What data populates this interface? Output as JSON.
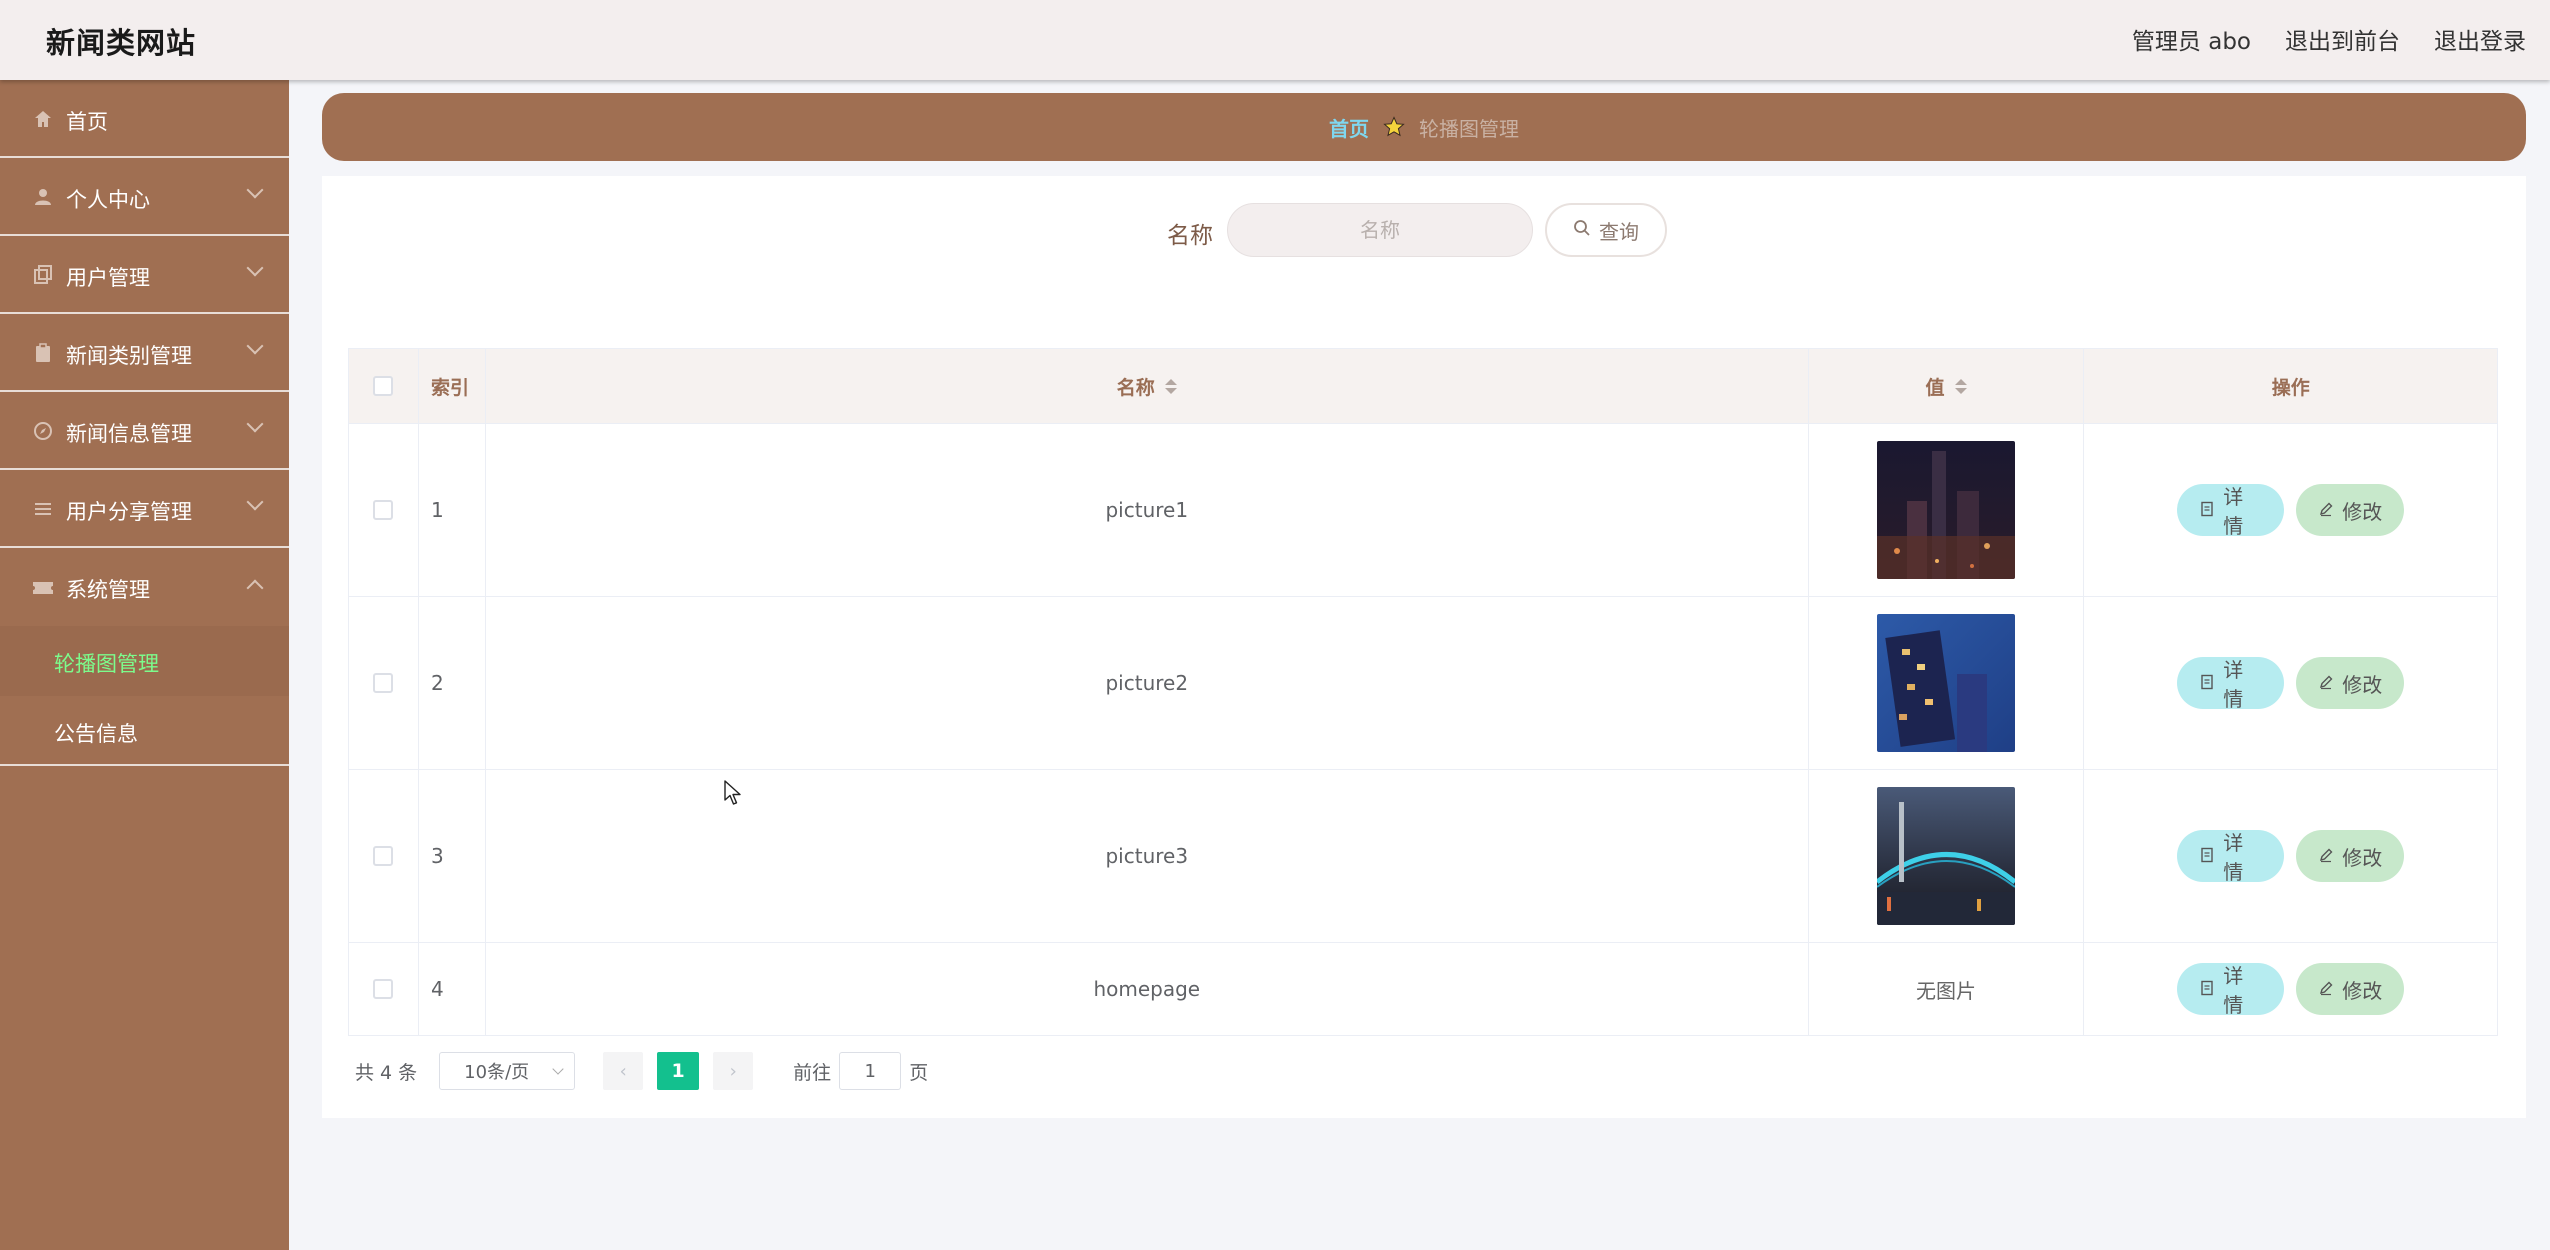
{
  "header": {
    "site_title": "新闻类网站",
    "admin_label": "管理员 abo",
    "to_frontend": "退出到前台",
    "logout": "退出登录"
  },
  "sidebar": {
    "items": [
      {
        "label": "首页",
        "icon": "home-icon"
      },
      {
        "label": "个人中心",
        "icon": "user-icon"
      },
      {
        "label": "用户管理",
        "icon": "copy-icon"
      },
      {
        "label": "新闻类别管理",
        "icon": "clipboard-icon"
      },
      {
        "label": "新闻信息管理",
        "icon": "compass-icon"
      },
      {
        "label": "用户分享管理",
        "icon": "list-icon"
      },
      {
        "label": "系统管理",
        "icon": "ticket-icon"
      }
    ],
    "sub_items": [
      {
        "label": "轮播图管理"
      },
      {
        "label": "公告信息"
      }
    ]
  },
  "breadcrumb": {
    "home": "首页",
    "current": "轮播图管理"
  },
  "search": {
    "label": "名称",
    "placeholder": "名称",
    "button": "查询"
  },
  "table": {
    "headers": {
      "index": "索引",
      "name": "名称",
      "value": "值",
      "ops": "操作"
    },
    "rows": [
      {
        "index": "1",
        "name": "picture1",
        "value": "image"
      },
      {
        "index": "2",
        "name": "picture2",
        "value": "image"
      },
      {
        "index": "3",
        "name": "picture3",
        "value": "image"
      },
      {
        "index": "4",
        "name": "homepage",
        "value": "无图片"
      }
    ],
    "detail_label": "详情",
    "edit_label": "修改"
  },
  "pager": {
    "total": "共 4 条",
    "page_size": "10条/页",
    "current_page": "1",
    "prev": "‹",
    "next": "›",
    "goto_prefix": "前往",
    "goto_value": "1",
    "goto_suffix": "页"
  },
  "colors": {
    "sidebar_bg": "#a06f52",
    "header_bg": "#f3eeee",
    "active_sub": "#7cfc8c",
    "page_active": "#13c08e",
    "detail_btn": "#b6ecf0",
    "edit_btn": "#c7e8cb"
  }
}
